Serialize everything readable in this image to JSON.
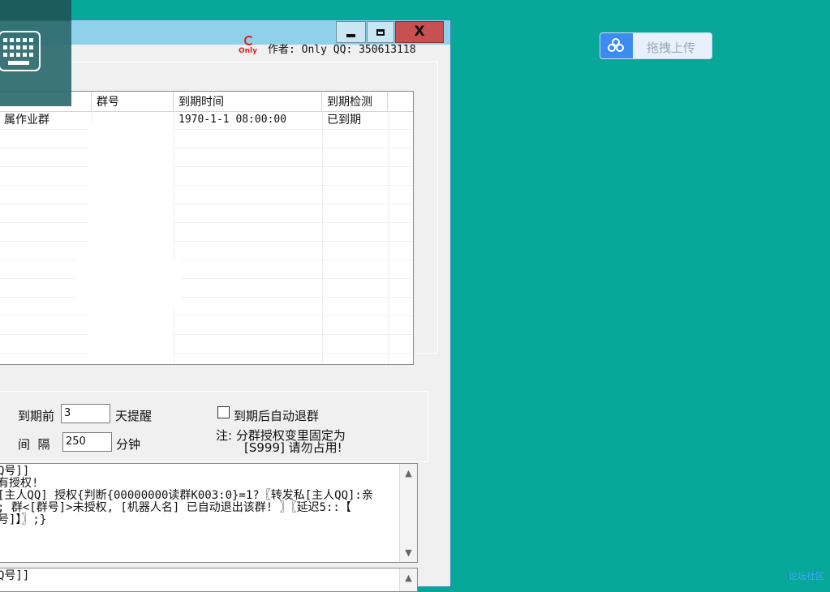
{
  "window": {
    "title": "",
    "controls": {
      "minimize": "minimize",
      "maximize": "maximize",
      "close": "close"
    },
    "author_text": "作者: Only QQ: 350613118",
    "logo_text": "Only"
  },
  "table": {
    "columns": [
      "",
      "群号",
      "到期时间",
      "到期检测"
    ],
    "rows": [
      {
        "name": "属作业群",
        "group_no": "",
        "expire_time": "1970-1-1 08:00:00",
        "check": "已到期"
      }
    ]
  },
  "settings": {
    "remind_before_label": "到期前",
    "remind_before_value": "3",
    "remind_suffix": "天提醒",
    "interval_label": "间  隔",
    "interval_value": "250",
    "interval_suffix": "分钟",
    "auto_quit_label": "到期后自动退群",
    "auto_quit_checked": false,
    "note_line1": "注: 分群授权变里固定为",
    "note_line2": "[S999] 请勿占用!"
  },
  "script_text": {
    "line1": "Q号]]",
    "line2": "有授权!",
    "line3": "[主人QQ] 授权{判断{00000000读群K003:0}=1?〖转发私[主人QQ]:亲",
    "line4": "; 群<[群号]>未授权, [机器人名] 已自动退出该群! 〗〖延迟5::【",
    "line5": "号]】〗;}"
  },
  "script_text2": {
    "line1": "Q号]]"
  },
  "upload_button": {
    "label": "拖拽上传",
    "icon": "baidu-cloud-icon"
  },
  "footer_text": "论坛社区",
  "colors": {
    "desktop": "#07a89a",
    "titlebar": "#8fd0ea",
    "close": "#c75050",
    "upload_icon": "#3b8bf0"
  }
}
